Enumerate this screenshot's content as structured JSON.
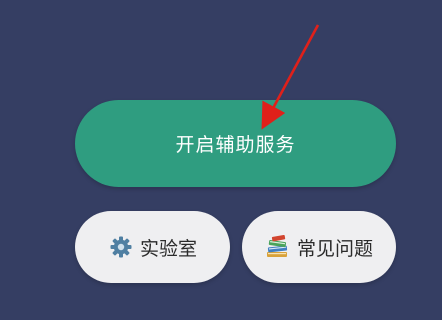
{
  "buttons": {
    "enable_service_label": "开启辅助服务",
    "lab_label": "实验室",
    "faq_label": "常见问题"
  },
  "icons": {
    "lab": "gear-icon",
    "faq": "books-icon",
    "annotation": "red-arrow"
  },
  "colors": {
    "background": "#353e63",
    "primary_button": "#2f9d80",
    "secondary_button": "#efeff1",
    "arrow": "#e0201a"
  }
}
